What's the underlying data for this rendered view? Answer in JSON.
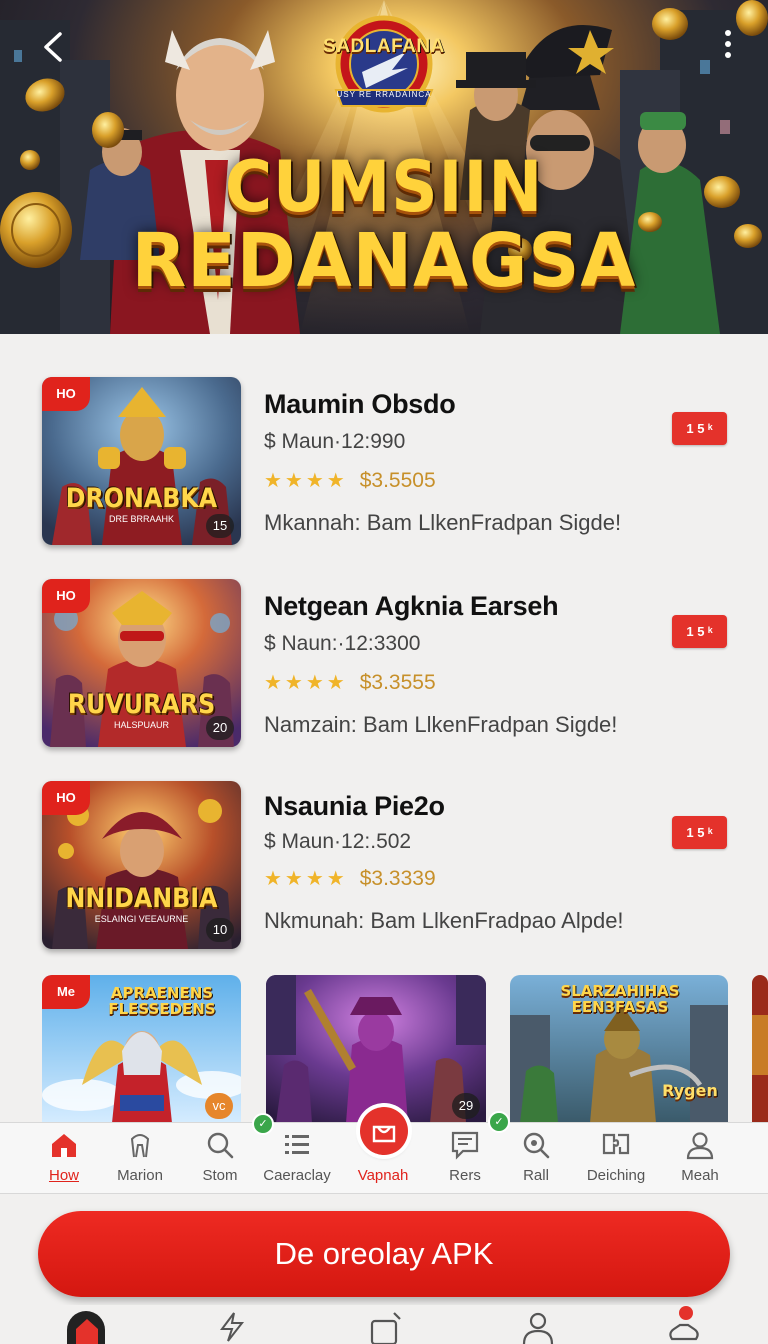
{
  "hero": {
    "badge_title": "SADLAFANA",
    "badge_subtitle": "USY RE RRADAINCA",
    "title_line1": "CUMSIIN",
    "title_line2": "REDANAGSA"
  },
  "list": [
    {
      "hot": "HO",
      "logo": "DRONABKA",
      "logo_sub": "DRE BRRAAHK",
      "count": "15",
      "name": "Maumin Obsdo",
      "price": "$ Maun·12:990",
      "stars": "★★★★",
      "rating": "$3.5505",
      "desc": "Mkannah: Bam LlkenFradpan Sigde!",
      "tag": "1 5 ᵏ"
    },
    {
      "hot": "HO",
      "logo": "RUVURARS",
      "logo_sub": "HALSPUAUR",
      "count": "20",
      "name": "Netgean Agknia Earseh",
      "price": "$ Naun:·12:3300",
      "stars": "★★★★",
      "rating": "$3.3555",
      "desc": "Namzain: Bam LlkenFradpan Sigde!",
      "tag": "1 5 ᵏ"
    },
    {
      "hot": "HO",
      "logo": "NNIDANBIA",
      "logo_sub": "ESLAINGI VEEAURNE",
      "count": "10",
      "name": "Nsaunia Pie2o",
      "price": "$ Maun·12:.502",
      "stars": "★★★★",
      "rating": "$3.3339",
      "desc": "Nkmunah: Bam LlkenFradpao Alpde!",
      "tag": "1 5 ᵏ"
    }
  ],
  "tiles": [
    {
      "hot": "Me",
      "logo": "APRAENENS FLESSEDENS",
      "count": "vc"
    },
    {
      "count": "29"
    },
    {
      "logo": "SLARZAHIHAS EEN3FASAS",
      "logo2": "Rygen"
    }
  ],
  "tabs": [
    {
      "label": "How",
      "icon": "home-icon"
    },
    {
      "label": "Marion",
      "icon": "tag-icon"
    },
    {
      "label": "Stom",
      "icon": "search-icon"
    },
    {
      "label": "Caeraclay",
      "icon": "list-icon"
    },
    {
      "label": "Vapnah",
      "icon": "gift-icon"
    },
    {
      "label": "Rers",
      "icon": "chat-icon"
    },
    {
      "label": "Rall",
      "icon": "zoom-icon"
    },
    {
      "label": "Deiching",
      "icon": "puzzle-icon"
    },
    {
      "label": "Meah",
      "icon": "user-icon"
    }
  ],
  "download": {
    "label": "De oreolay APK"
  },
  "colors": {
    "accent": "#e4322b",
    "gold": "#ffd23b",
    "star": "#f0b429",
    "background": "#f1f0ef"
  }
}
